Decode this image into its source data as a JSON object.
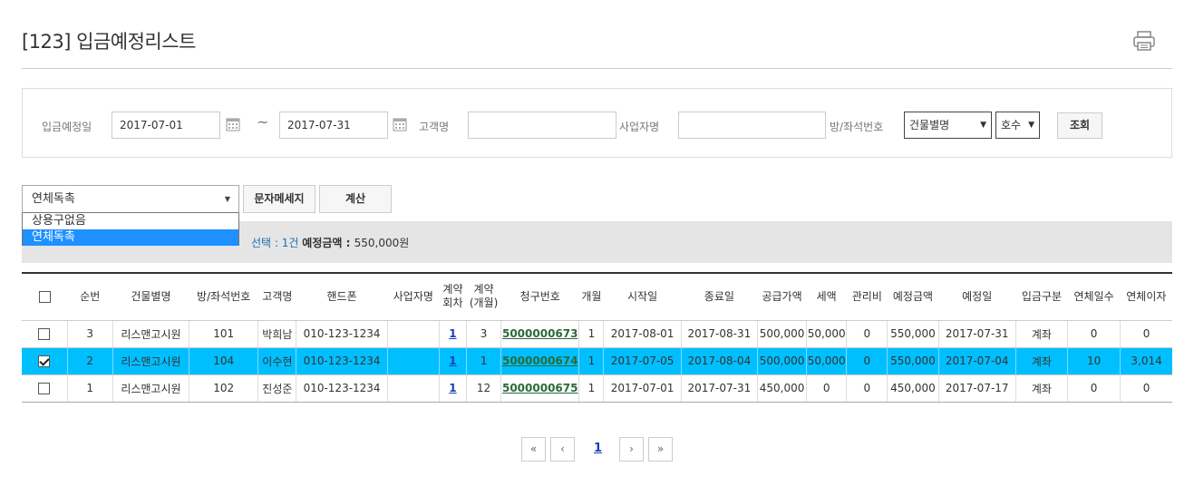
{
  "page": {
    "title": "[123] 입금예정리스트"
  },
  "search": {
    "date_label": "입금예정일",
    "date_from": "2017-07-01",
    "date_tilde": "~",
    "date_to": "2017-07-31",
    "customer_label": "고객명",
    "customer_value": "",
    "business_label": "사업자명",
    "business_value": "",
    "room_label": "방/좌석번호",
    "building_select": "건물별명",
    "room_select": "호수",
    "search_button": "조회"
  },
  "actions": {
    "template_select": "연체독촉",
    "template_options": [
      "상용구없음",
      "연체독촉"
    ],
    "template_selected_index": 1,
    "sms_button": "문자메세지",
    "calc_button": "계산"
  },
  "summary": {
    "selected_label": "선택 : ",
    "selected_count": "1건",
    "amount_label": "예정금액 : ",
    "amount_value": "550,000원"
  },
  "table": {
    "headers": [
      "",
      "순번",
      "건물별명",
      "방/좌석번호",
      "고객명",
      "핸드폰",
      "사업자명",
      "계약\n회차",
      "계약\n(개월)",
      "청구번호",
      "개월",
      "시작일",
      "종료일",
      "공급가액",
      "세액",
      "관리비",
      "예정금액",
      "예정일",
      "입금구분",
      "연체일수",
      "연체이자"
    ],
    "rows": [
      {
        "checked": false,
        "no": "3",
        "building": "리스맨고시원",
        "room": "101",
        "customer": "박희남",
        "phone": "010-123-1234",
        "business": "",
        "round": "1",
        "months_contract": "3",
        "bill_no": "5000000673",
        "months": "1",
        "start": "2017-08-01",
        "end": "2017-08-31",
        "supply": "500,000",
        "tax": "50,000",
        "mgmt": "0",
        "amount": "550,000",
        "due": "2017-07-31",
        "pay_type": "계좌",
        "overdue_days": "0",
        "overdue_interest": "0"
      },
      {
        "checked": true,
        "no": "2",
        "building": "리스맨고시원",
        "room": "104",
        "customer": "이수현",
        "phone": "010-123-1234",
        "business": "",
        "round": "1",
        "months_contract": "1",
        "bill_no": "5000000674",
        "months": "1",
        "start": "2017-07-05",
        "end": "2017-08-04",
        "supply": "500,000",
        "tax": "50,000",
        "mgmt": "0",
        "amount": "550,000",
        "due": "2017-07-04",
        "pay_type": "계좌",
        "overdue_days": "10",
        "overdue_interest": "3,014"
      },
      {
        "checked": false,
        "no": "1",
        "building": "리스맨고시원",
        "room": "102",
        "customer": "진성준",
        "phone": "010-123-1234",
        "business": "",
        "round": "1",
        "months_contract": "12",
        "bill_no": "5000000675",
        "months": "1",
        "start": "2017-07-01",
        "end": "2017-07-31",
        "supply": "450,000",
        "tax": "0",
        "mgmt": "0",
        "amount": "450,000",
        "due": "2017-07-17",
        "pay_type": "계좌",
        "overdue_days": "0",
        "overdue_interest": "0"
      }
    ]
  },
  "pager": {
    "first": "«",
    "prev": "‹",
    "current": "1",
    "next": "›",
    "last": "»"
  },
  "colors": {
    "selected_row": "#00bfff",
    "dropdown_highlight": "#1e90ff",
    "link_blue": "#1a3fb9",
    "link_green": "#2a6a3a"
  }
}
